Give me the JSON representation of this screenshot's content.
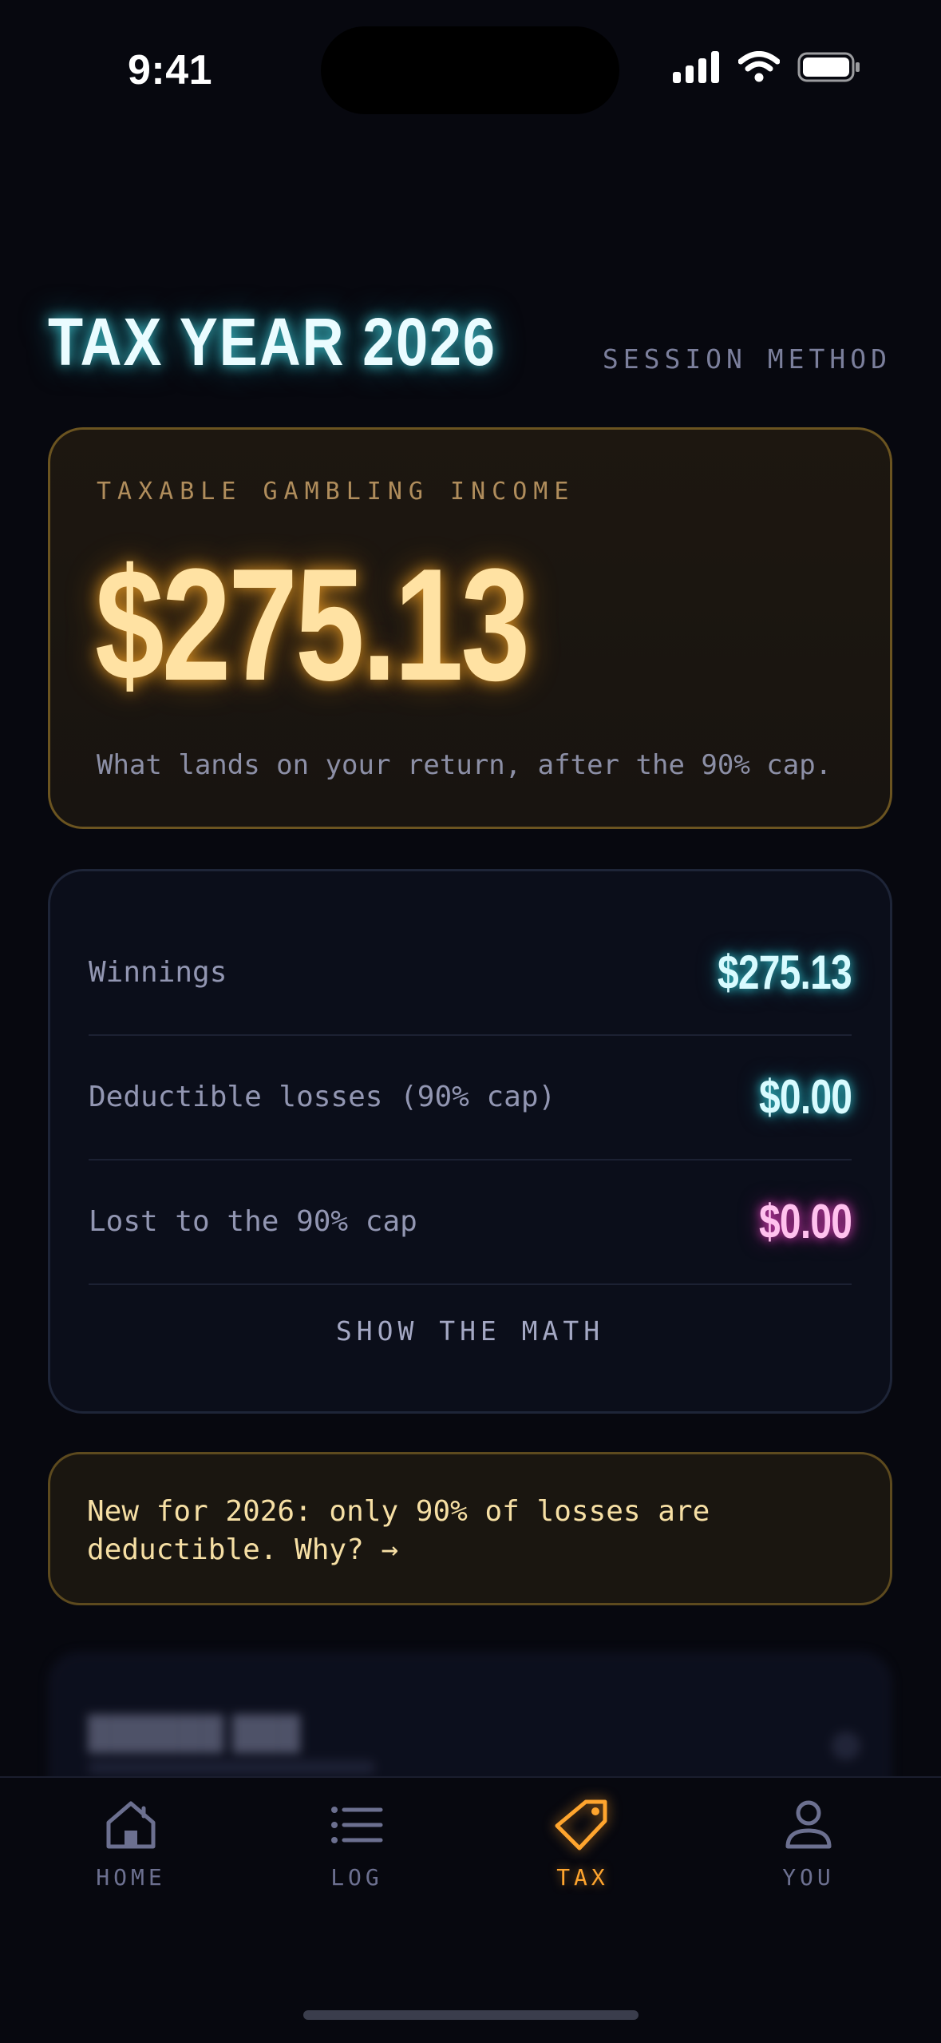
{
  "status_bar": {
    "time": "9:41"
  },
  "header": {
    "title": "TAX YEAR 2026",
    "method_link": "SESSION METHOD"
  },
  "income_card": {
    "label": "TAXABLE GAMBLING INCOME",
    "amount": "$275.13",
    "note": "What lands on your return, after the 90% cap."
  },
  "breakdown": {
    "rows": [
      {
        "label": "Winnings",
        "value": "$275.13",
        "color": "#d8fbff"
      },
      {
        "label": "Deductible losses (90% cap)",
        "value": "$0.00",
        "color": "#d8fbff"
      },
      {
        "label": "Lost to the 90% cap",
        "value": "$0.00",
        "color": "#ffc2ee"
      }
    ],
    "show_math": "SHOW THE MATH"
  },
  "notice": {
    "text": "New for 2026: only 90% of losses are deductible. Why? →"
  },
  "tabs": [
    {
      "label": "HOME",
      "icon": "home-icon",
      "active": false
    },
    {
      "label": "LOG",
      "icon": "list-icon",
      "active": false
    },
    {
      "label": "TAX",
      "icon": "tag-icon",
      "active": true
    },
    {
      "label": "YOU",
      "icon": "person-icon",
      "active": false
    }
  ],
  "colors": {
    "accent": "#ffa52e",
    "cyan": "#46dce6",
    "pink": "#f046c8",
    "background": "#07080f"
  }
}
